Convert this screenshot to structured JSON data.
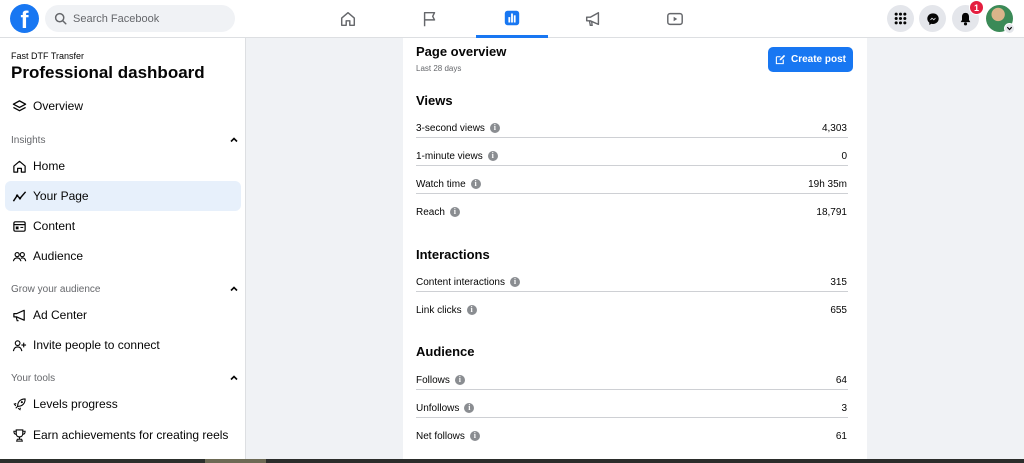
{
  "header": {
    "logo_letter": "f",
    "search_placeholder": "Search Facebook",
    "nav_tabs": [
      "home-icon",
      "flag-icon",
      "insights-icon",
      "megaphone-icon",
      "video-icon"
    ],
    "notifications_count": "1",
    "accent_color": "#1877f2"
  },
  "sidebar": {
    "page_name": "Fast DTF Transfer",
    "title": "Professional dashboard",
    "overview": "Overview",
    "sections": {
      "insights": "Insights",
      "grow": "Grow your audience",
      "tools": "Your tools"
    },
    "items": {
      "home": "Home",
      "your_page": "Your Page",
      "content": "Content",
      "audience": "Audience",
      "ad_center": "Ad Center",
      "invite": "Invite people to connect",
      "levels": "Levels progress",
      "achievements": "Earn achievements for creating reels"
    }
  },
  "main": {
    "title": "Page overview",
    "subtitle": "Last 28 days",
    "create_post": "Create post",
    "views": {
      "heading": "Views",
      "rows": [
        {
          "label": "3-second views",
          "value": "4,303"
        },
        {
          "label": "1-minute views",
          "value": "0"
        },
        {
          "label": "Watch time",
          "value": "19h 35m"
        },
        {
          "label": "Reach",
          "value": "18,791"
        }
      ]
    },
    "interactions": {
      "heading": "Interactions",
      "rows": [
        {
          "label": "Content interactions",
          "value": "315"
        },
        {
          "label": "Link clicks",
          "value": "655"
        }
      ]
    },
    "audience": {
      "heading": "Audience",
      "rows": [
        {
          "label": "Follows",
          "value": "64"
        },
        {
          "label": "Unfollows",
          "value": "3"
        },
        {
          "label": "Net follows",
          "value": "61"
        }
      ]
    }
  }
}
